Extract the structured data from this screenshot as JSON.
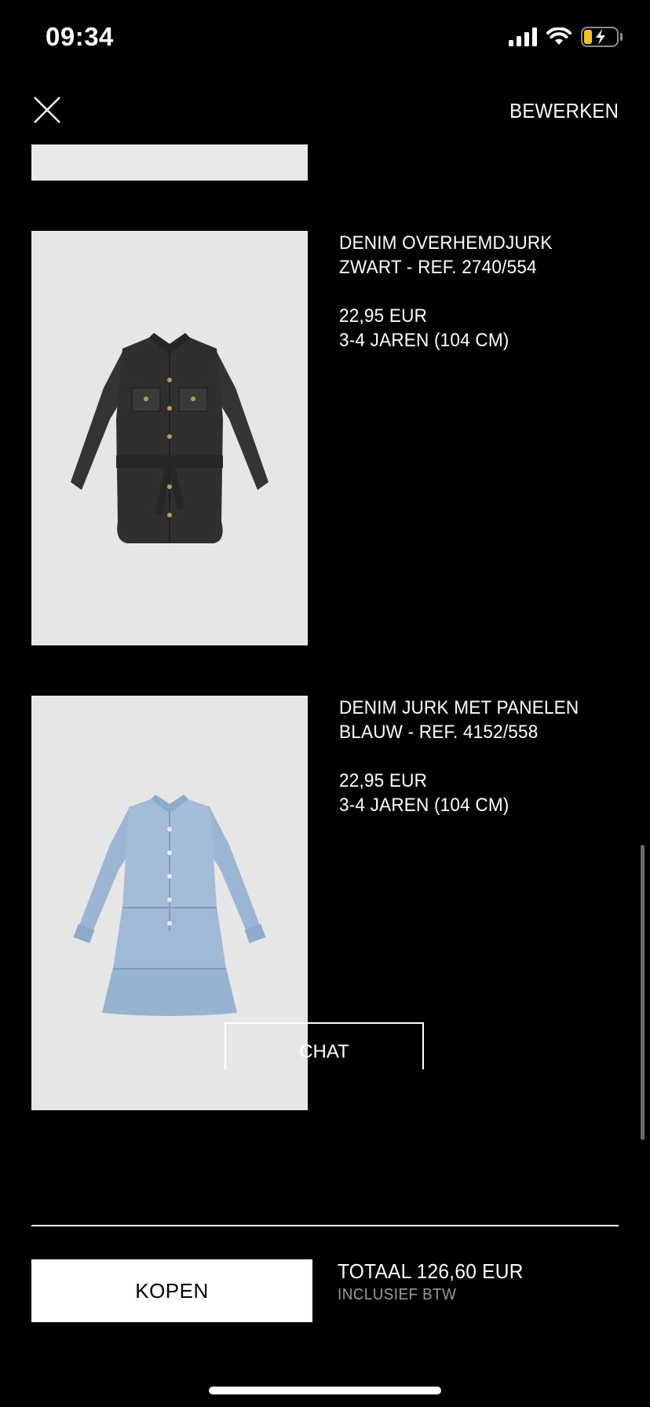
{
  "status_bar": {
    "time": "09:34",
    "icons": [
      "cellular-signal-icon",
      "wifi-icon",
      "battery-charging-icon"
    ]
  },
  "header": {
    "close_icon": "close-icon",
    "edit_label": "BEWERKEN"
  },
  "products": [
    {
      "name": "DENIM OVERHEMDJURK",
      "color_ref": "ZWART - REF. 2740/554",
      "price": "22,95 EUR",
      "size": "3-4 JAREN (104 CM)",
      "image": "black-denim-shirt-dress-image"
    },
    {
      "name": "DENIM JURK MET PANELEN",
      "color_ref": "BLAUW - REF. 4152/558",
      "price": "22,95 EUR",
      "size": "3-4 JAREN (104 CM)",
      "image": "blue-denim-tiered-dress-image"
    }
  ],
  "chat_label": "CHAT",
  "footer": {
    "buy_label": "KOPEN",
    "total": "TOTAAL 126,60 EUR",
    "vat_note": "INCLUSIEF BTW"
  },
  "colors": {
    "background": "#000000",
    "text": "#ffffff",
    "secondary_text": "#9a9a9a",
    "battery_accent": "#f5c518"
  }
}
